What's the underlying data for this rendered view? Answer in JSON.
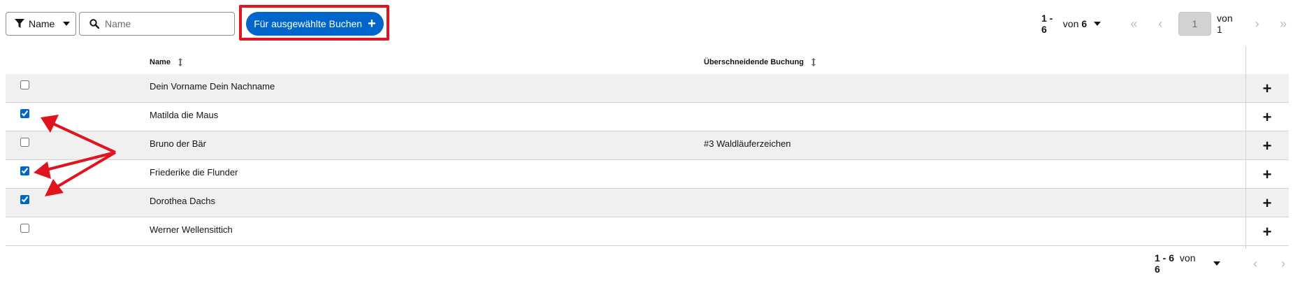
{
  "toolbar": {
    "filter_attribute": "Name",
    "search_placeholder": "Name",
    "search_value": "",
    "bulk_book_label": "Für ausgewählte Buchen",
    "bulk_book_plus": "+"
  },
  "pagination_top": {
    "range": "1 - 6",
    "of_word": "von",
    "total": "6",
    "current_page": "1",
    "page_of": "von 1"
  },
  "table": {
    "columns": [
      "Name",
      "Überschneidende Buchung"
    ],
    "add_label": "+",
    "rows": [
      {
        "name": "Dein Vorname Dein Nachname",
        "overlap": "",
        "checked": false
      },
      {
        "name": "Matilda die Maus",
        "overlap": "",
        "checked": true
      },
      {
        "name": "Bruno der Bär",
        "overlap": "#3 Waldläuferzeichen",
        "checked": false
      },
      {
        "name": "Friederike die Flunder",
        "overlap": "",
        "checked": true
      },
      {
        "name": "Dorothea Dachs",
        "overlap": "",
        "checked": true
      },
      {
        "name": "Werner Wellensittich",
        "overlap": "",
        "checked": false
      }
    ]
  },
  "pagination_bottom": {
    "range": "1 - 6",
    "of_word": "von",
    "total": "6"
  },
  "colors": {
    "primary": "#0066cc",
    "annotation": "#e0141e",
    "row_alt": "#f0f0f0"
  }
}
